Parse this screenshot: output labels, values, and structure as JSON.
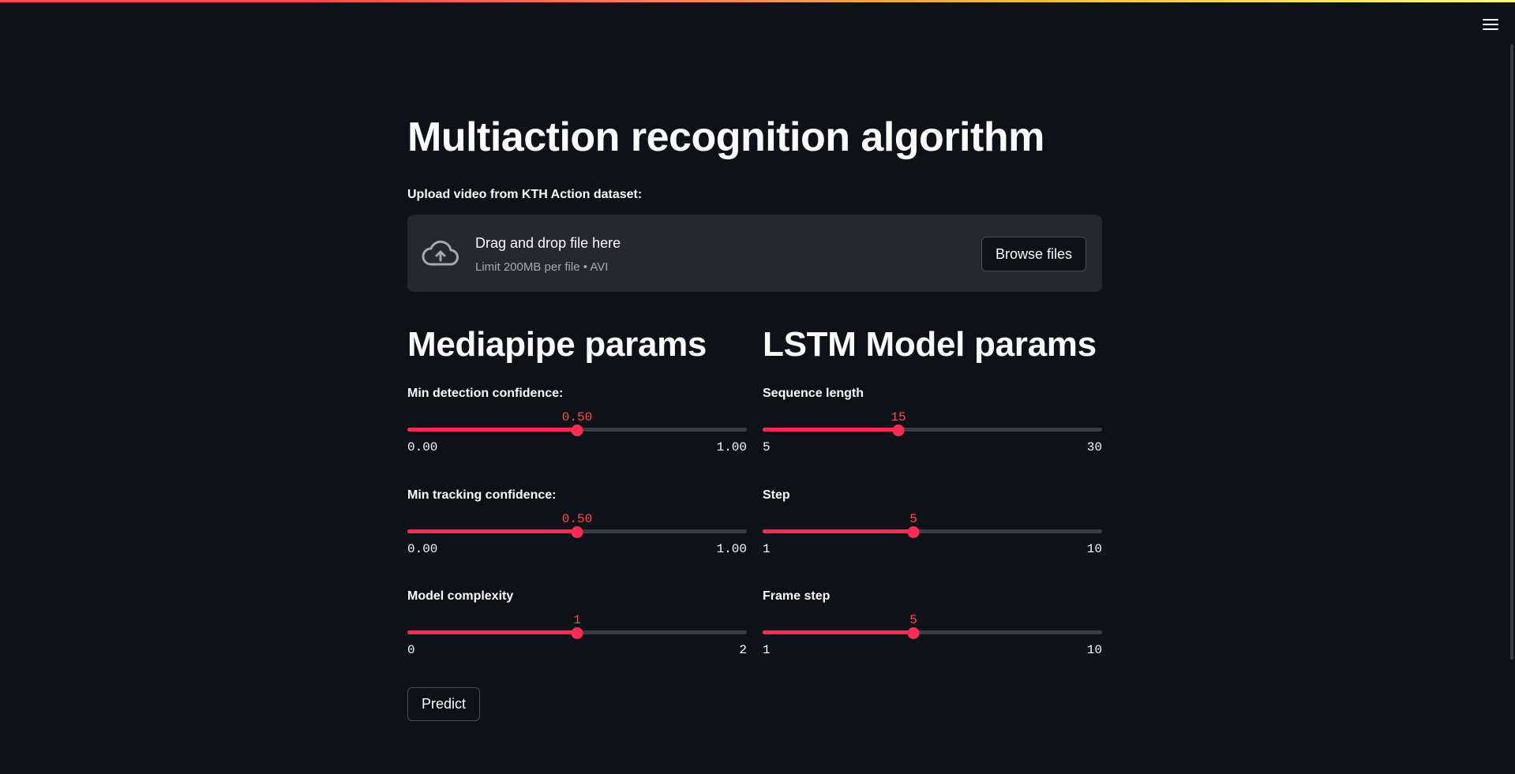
{
  "page": {
    "title": "Multiaction recognition algorithm"
  },
  "upload": {
    "label": "Upload video from KTH Action dataset:",
    "dropzone_title": "Drag and drop file here",
    "dropzone_subtitle": "Limit 200MB per file • AVI",
    "browse_label": "Browse files",
    "icon": "cloud-upload-icon"
  },
  "mediapipe": {
    "title": "Mediapipe params",
    "sliders": [
      {
        "label": "Min detection confidence:",
        "value": "0.50",
        "min": "0.00",
        "max": "1.00",
        "fraction": 0.5
      },
      {
        "label": "Min tracking confidence:",
        "value": "0.50",
        "min": "0.00",
        "max": "1.00",
        "fraction": 0.5
      },
      {
        "label": "Model complexity",
        "value": "1",
        "min": "0",
        "max": "2",
        "fraction": 0.5
      }
    ]
  },
  "lstm": {
    "title": "LSTM Model params",
    "sliders": [
      {
        "label": "Sequence length",
        "value": "15",
        "min": "5",
        "max": "30",
        "fraction": 0.4
      },
      {
        "label": "Step",
        "value": "5",
        "min": "1",
        "max": "10",
        "fraction": 0.4444
      },
      {
        "label": "Frame step",
        "value": "5",
        "min": "1",
        "max": "10",
        "fraction": 0.4444
      }
    ]
  },
  "actions": {
    "predict_label": "Predict"
  },
  "colors": {
    "background": "#0e1117",
    "accent": "#ff2b52",
    "dropzone": "#262730",
    "track": "#3a3c44"
  }
}
